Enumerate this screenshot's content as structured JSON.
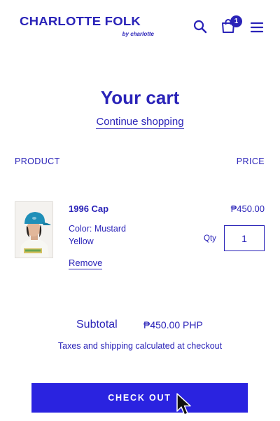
{
  "header": {
    "brand": "CHARLOTTE FOLK",
    "brand_sub": "by charlotte",
    "cart_count": "1",
    "icons": [
      "search-icon",
      "shopping-bag-icon",
      "hamburger-menu-icon"
    ]
  },
  "cart": {
    "title": "Your cart",
    "continue_label": "Continue shopping",
    "columns": {
      "product": "PRODUCT",
      "price": "PRICE"
    },
    "items": [
      {
        "name": "1996 Cap",
        "price": "₱450.00",
        "variant": "Color: Mustard Yellow",
        "qty_label": "Qty",
        "qty_value": "1",
        "remove_label": "Remove"
      }
    ],
    "subtotal_label": "Subtotal",
    "subtotal_value": "₱450.00 PHP",
    "tax_note": "Taxes and shipping calculated at checkout",
    "checkout_label": "CHECK OUT"
  },
  "colors": {
    "brand": "#2a23b8",
    "button": "#2a23e0",
    "background": "#ffffff"
  }
}
